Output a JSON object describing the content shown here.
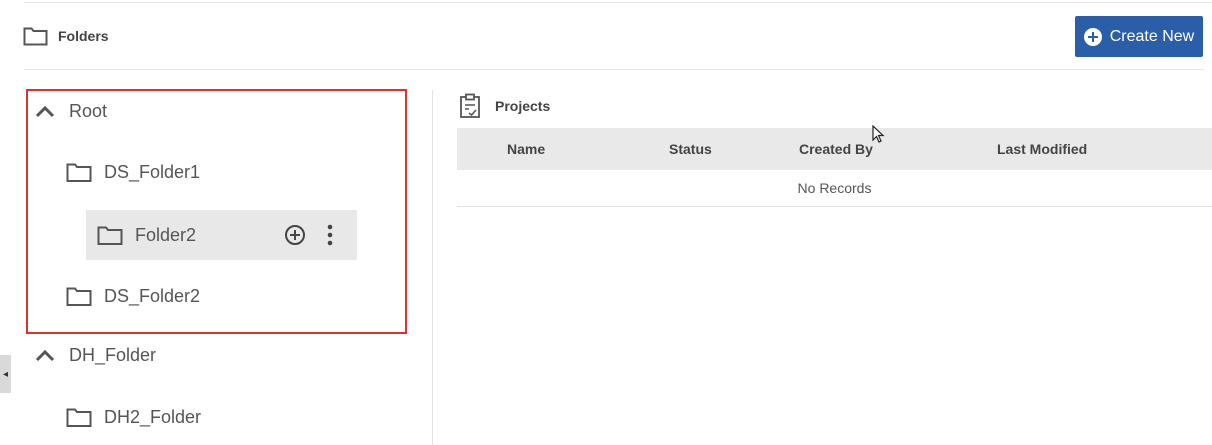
{
  "header": {
    "title": "Folders",
    "folder_icon": "folder-icon",
    "create_button": {
      "label": "Create New",
      "icon": "plus-circle-icon"
    }
  },
  "tree": {
    "nodes": [
      {
        "label": "Root",
        "icon": "chevron-up-icon",
        "expanded": true
      },
      {
        "label": "DS_Folder1",
        "icon": "folder-icon"
      },
      {
        "label": "Folder2",
        "icon": "folder-icon",
        "selected": true,
        "actions": [
          "add-circle-icon",
          "more-vertical-icon"
        ]
      },
      {
        "label": "DS_Folder2",
        "icon": "folder-icon"
      },
      {
        "label": "DH_Folder",
        "icon": "chevron-up-icon",
        "expanded": true
      },
      {
        "label": "DH2_Folder",
        "icon": "folder-icon"
      }
    ]
  },
  "projects": {
    "title": "Projects",
    "icon": "clipboard-check-icon",
    "columns": [
      "Name",
      "Status",
      "Created By",
      "Last Modified"
    ],
    "empty_text": "No Records"
  },
  "colors": {
    "accent": "#2b5ea8",
    "highlight_border": "#d83434",
    "selected_row": "#e8e8e8",
    "table_header": "#e9e9e9"
  }
}
